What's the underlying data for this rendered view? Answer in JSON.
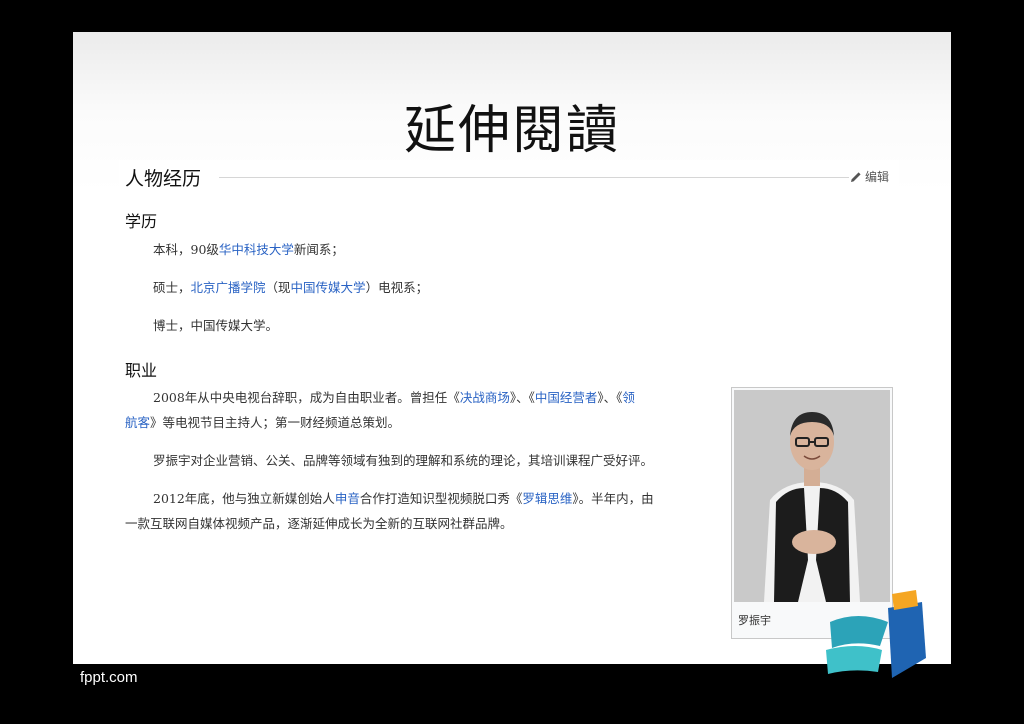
{
  "slide": {
    "title": "延伸閱讀"
  },
  "article": {
    "section_heading": "人物经历",
    "edit_label": "编辑",
    "education": {
      "heading": "学历",
      "items": [
        {
          "pre": "本科，90级",
          "link": "华中科技大学",
          "post": "新闻系；"
        },
        {
          "pre": "硕士，",
          "link": "北京广播学院",
          "mid": "（现",
          "link2": "中国传媒大学",
          "post": "）电视系；"
        },
        {
          "text": "博士，中国传媒大学。"
        }
      ]
    },
    "career": {
      "heading": "职业",
      "p1": {
        "t1": "2008年从中央电视台辞职，成为自由职业者。曾担任《",
        "l1": "决战商场",
        "t2": "》、《",
        "l2": "中国经营者",
        "t3": "》、《",
        "l3a": "领",
        "l3b": "航客",
        "t4": "》等电视节目主持人；第一财经频道总策划。"
      },
      "p2": "罗振宇对企业营销、公关、品牌等领域有独到的理解和系统的理论，其培训课程广受好评。",
      "p3": {
        "t1": "2012年底，他与独立新媒创始人",
        "l1": "申音",
        "t2": "合作打造知识型视频脱口秀《",
        "l2": "罗辑思维",
        "t3": "》。半年内，由",
        "line2": "一款互联网自媒体视频产品，逐渐延伸成长为全新的互联网社群品牌。"
      }
    },
    "figure_caption": "罗振宇"
  },
  "footer": {
    "brand": "fppt.com"
  },
  "colors": {
    "link": "#2a63c4",
    "background": "#000000"
  }
}
